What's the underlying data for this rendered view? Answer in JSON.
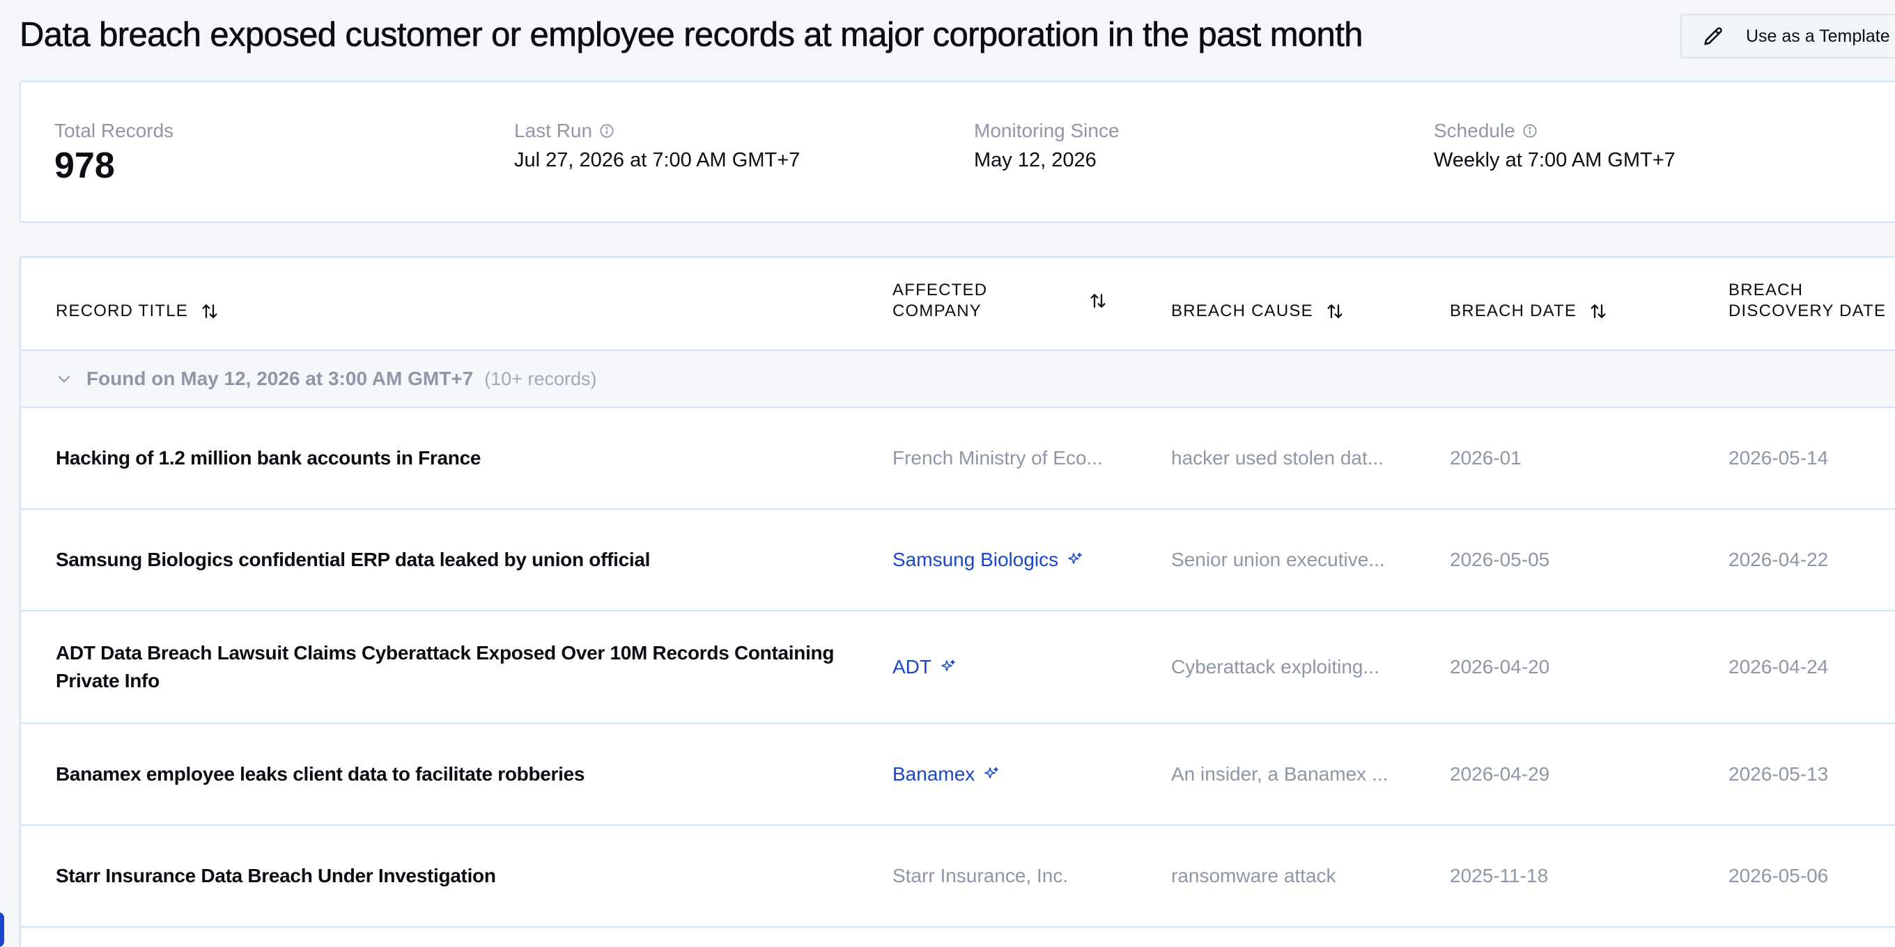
{
  "page": {
    "title": "Data breach exposed customer or employee records at major corporation in the past month",
    "template_button_label": "Use as a Template"
  },
  "stats": {
    "total_records": {
      "label": "Total Records",
      "value": "978"
    },
    "last_run": {
      "label": "Last Run",
      "value": "Jul 27, 2026 at 7:00 AM GMT+7"
    },
    "monitoring_since": {
      "label": "Monitoring Since",
      "value": "May 12, 2026"
    },
    "schedule": {
      "label": "Schedule",
      "value": "Weekly at 7:00 AM GMT+7"
    }
  },
  "table": {
    "columns": {
      "record_title": "RECORD TITLE",
      "affected_company_line1": "AFFECTED",
      "affected_company_line2": "COMPANY",
      "breach_cause": "BREACH CAUSE",
      "breach_date": "BREACH DATE",
      "discovery_line1": "BREACH",
      "discovery_line2": "DISCOVERY DATE"
    },
    "group": {
      "label": "Found on May 12, 2026 at 3:00 AM GMT+7",
      "count": "(10+ records)"
    },
    "rows": [
      {
        "title": "Hacking of 1.2 million bank accounts in France",
        "company": "French Ministry of Eco...",
        "company_linked": false,
        "cause": "hacker used stolen dat...",
        "breach_date": "2026-01",
        "discovery_date": "2026-05-14"
      },
      {
        "title": "Samsung Biologics confidential ERP data leaked by union official",
        "company": "Samsung Biologics",
        "company_linked": true,
        "cause": "Senior union executive...",
        "breach_date": "2026-05-05",
        "discovery_date": "2026-04-22"
      },
      {
        "title": "ADT Data Breach Lawsuit Claims Cyberattack Exposed Over 10M Records Containing Private Info",
        "company": "ADT",
        "company_linked": true,
        "cause": "Cyberattack exploiting...",
        "breach_date": "2026-04-20",
        "discovery_date": "2026-04-24"
      },
      {
        "title": "Banamex employee leaks client data to facilitate robberies",
        "company": "Banamex",
        "company_linked": true,
        "cause": "An insider, a Banamex ...",
        "breach_date": "2026-04-29",
        "discovery_date": "2026-05-13"
      },
      {
        "title": "Starr Insurance Data Breach Under Investigation",
        "company": "Starr Insurance, Inc.",
        "company_linked": false,
        "cause": "ransomware attack",
        "breach_date": "2025-11-18",
        "discovery_date": "2026-05-06"
      }
    ]
  },
  "icons": {
    "template": "pencil-icon",
    "info": "info-icon",
    "sort": "sort-icon",
    "collapse": "chevron-down-icon",
    "ai_enriched": "sparkle-icon"
  },
  "colors": {
    "link": "#1a47c9",
    "muted": "#8f97a6",
    "border": "#d6e4f7",
    "background": "#f4f6fa"
  }
}
